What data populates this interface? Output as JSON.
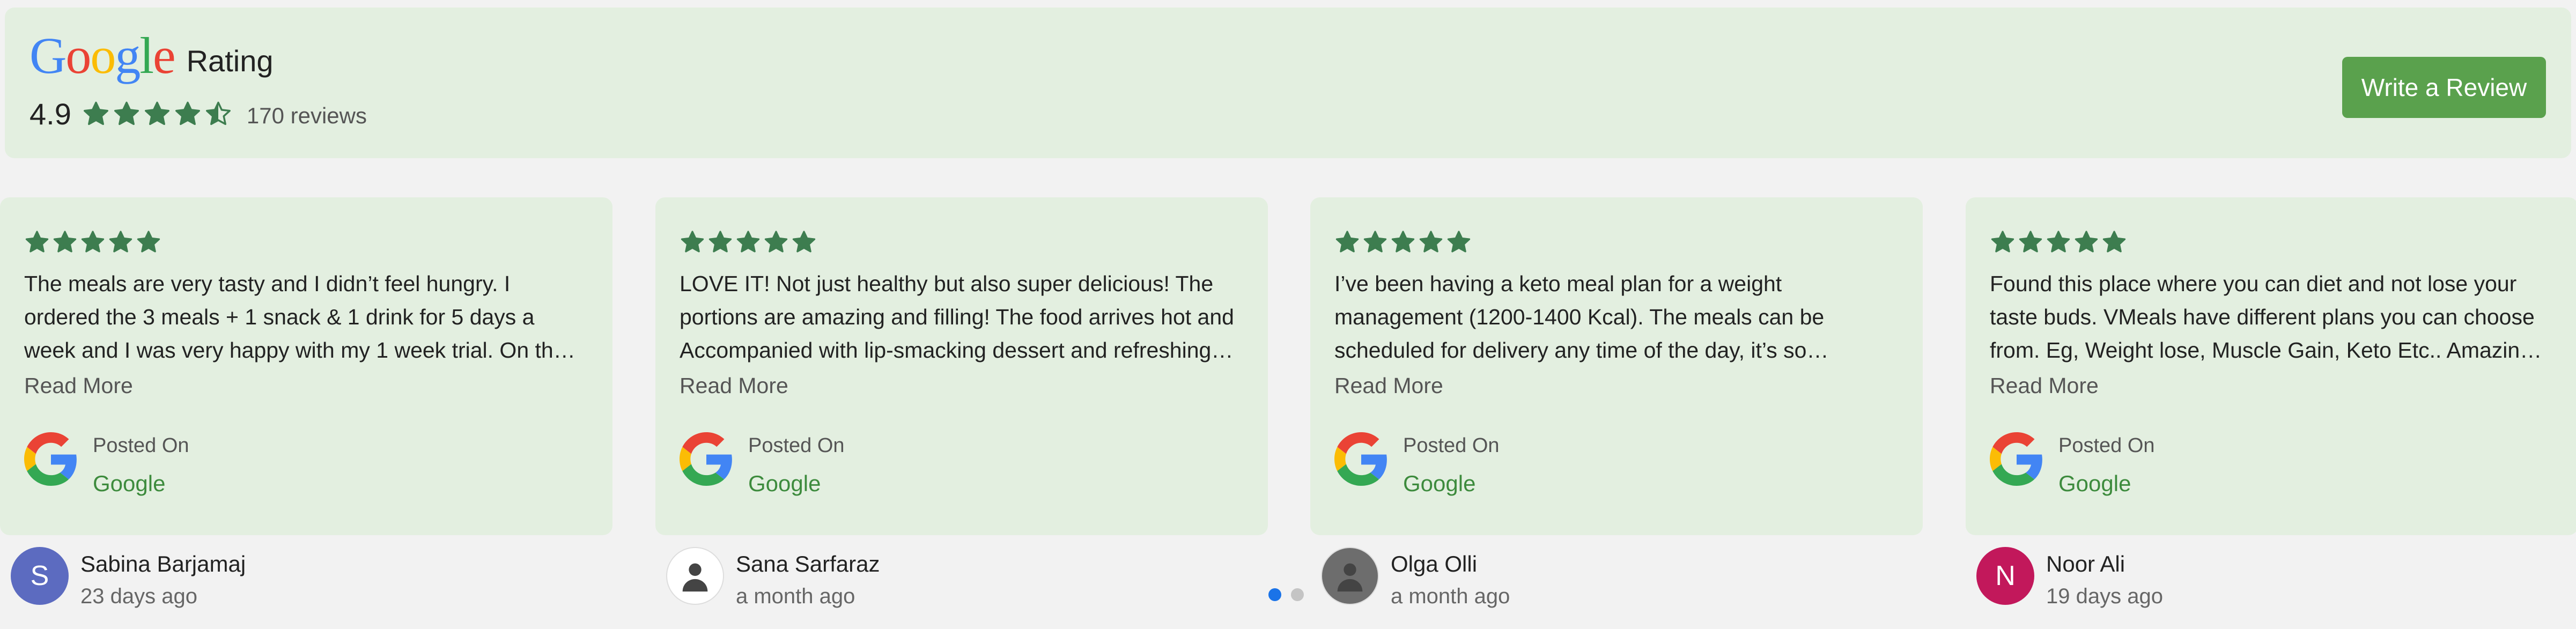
{
  "header": {
    "logo_letters": [
      {
        "ch": "G",
        "color": "#4285F4"
      },
      {
        "ch": "o",
        "color": "#EA4335"
      },
      {
        "ch": "o",
        "color": "#FBBC05"
      },
      {
        "ch": "g",
        "color": "#4285F4"
      },
      {
        "ch": "l",
        "color": "#34A853"
      },
      {
        "ch": "e",
        "color": "#EA4335"
      }
    ],
    "rating_label": "Rating",
    "score": "4.9",
    "stars_value": 4.5,
    "reviews_count": "170 reviews",
    "write_review_label": "Write a Review"
  },
  "colors": {
    "star": "#3d7d4f",
    "card_bg": "#e3efe0",
    "button": "#5aa14d",
    "source": "#3d8b3d",
    "dot_active": "#1a73e8",
    "dot_inactive": "#c4c4c4"
  },
  "reviews": [
    {
      "stars": 5,
      "text": "The meals are very tasty and I didn’t feel hungry. I ordered the 3 meals + 1 snack & 1 drink for 5 days a week and I was very happy with my 1 week trial. On the weekend I'm allowing…",
      "read_more": "Read More",
      "posted_on": "Posted On",
      "source": "Google",
      "author": "Sabina Barjamaj",
      "time": "23 days ago",
      "avatar_letter": "S",
      "avatar_color": "#5c6bc0"
    },
    {
      "stars": 5,
      "text": "LOVE IT! Not just healthy but also super delicious! The portions are amazing and filling! The food arrives hot and Accompanied with lip-smacking dessert and refreshing juice!…",
      "read_more": "Read More",
      "posted_on": "Posted On",
      "source": "Google",
      "author": "Sana Sarfaraz",
      "time": "a month ago",
      "avatar_letter": "",
      "avatar_color": "#ffffff"
    },
    {
      "stars": 5,
      "text": "I’ve been having a keto meal plan for a weight management (1200-1400 Kcal). The meals can be scheduled for delivery any time of the day, it’s so convenient. The menu was really…",
      "read_more": "Read More",
      "posted_on": "Posted On",
      "source": "Google",
      "author": "Olga Olli",
      "time": "a month ago",
      "avatar_letter": "",
      "avatar_color": "#6d6d6d"
    },
    {
      "stars": 5,
      "text": "Found this place where you can diet and not lose your taste buds. VMeals have different plans you can choose from. Eg, Weight lose, Muscle Gain, Keto Etc.. Amazing experience the…",
      "read_more": "Read More",
      "posted_on": "Posted On",
      "source": "Google",
      "author": "Noor Ali",
      "time": "19 days ago",
      "avatar_letter": "N",
      "avatar_color": "#c2185b"
    }
  ],
  "pagination": {
    "pages": 2,
    "active_index": 0
  }
}
